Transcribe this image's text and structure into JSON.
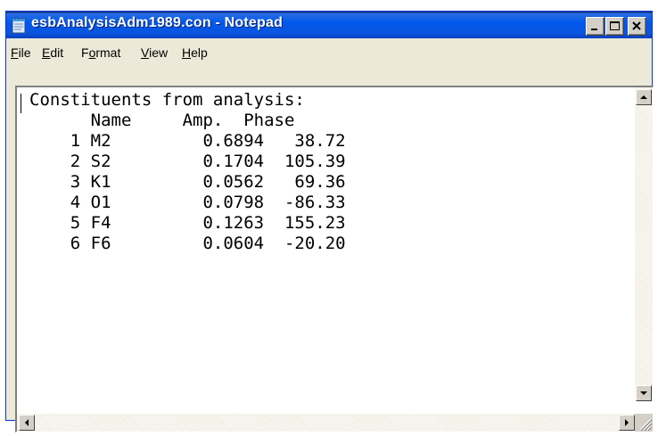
{
  "window": {
    "title": "esbAnalysisAdm1989.con - Notepad",
    "title_bar_color": "#0058ee",
    "icon": "notepad-icon"
  },
  "menu": {
    "file": {
      "label": "File",
      "accel": "F",
      "rest": "ile"
    },
    "edit": {
      "label": "Edit",
      "accel": "E",
      "rest": "dit"
    },
    "format": {
      "label": "Format",
      "pre": "F",
      "accel": "o",
      "rest": "rmat"
    },
    "view": {
      "label": "View",
      "accel": "V",
      "rest": "iew"
    },
    "help": {
      "label": "Help",
      "accel": "H",
      "rest": "elp"
    }
  },
  "document": {
    "lines": [
      "Constituents from analysis:",
      "      Name     Amp.  Phase",
      "    1 M2         0.6894   38.72",
      "    2 S2         0.1704  105.39",
      "    3 K1         0.0562   69.36",
      "    4 O1         0.0798  -86.33",
      "    5 F4         0.1263  155.23",
      "    6 F6         0.0604  -20.20"
    ]
  },
  "icons": {
    "minimize": "minimize-icon",
    "maximize": "maximize-icon",
    "close": "close-icon",
    "scroll_up": "arrow-up-icon",
    "scroll_down": "arrow-down-icon",
    "scroll_left": "arrow-left-icon",
    "scroll_right": "arrow-right-icon",
    "resize": "resize-grip-icon"
  }
}
